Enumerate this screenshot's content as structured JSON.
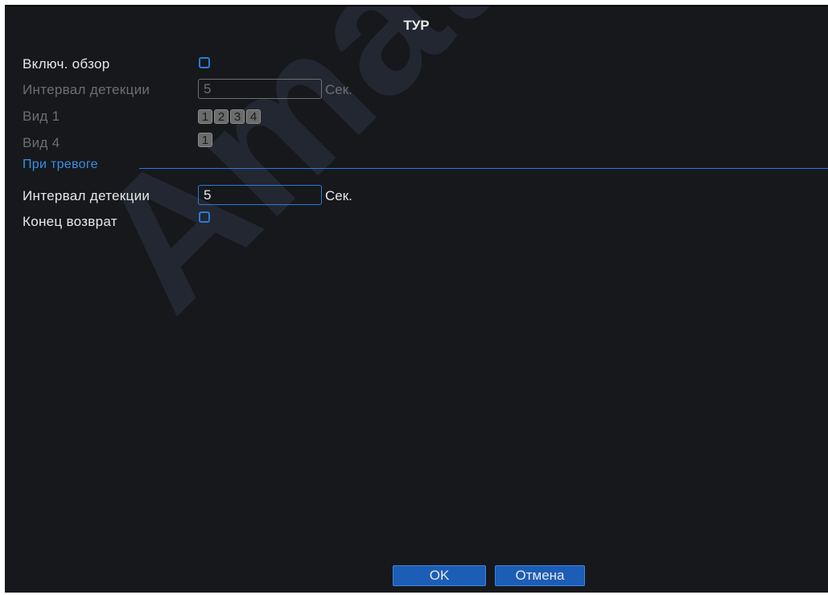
{
  "window": {
    "title": "ТУР"
  },
  "tour": {
    "enable_label": "Включ. обзор",
    "interval_label": "Интервал детекции",
    "interval_value": "5",
    "interval_unit": "Сек.",
    "view1_label": "Вид 1",
    "view1_channels": [
      "1",
      "2",
      "3",
      "4"
    ],
    "view4_label": "Вид 4",
    "view4_channels": [
      "1"
    ]
  },
  "alarm": {
    "section_label": "При тревоге",
    "interval_label": "Интервал детекции",
    "interval_value": "5",
    "interval_unit": "Сек.",
    "return_label": "Конец возврат"
  },
  "watermark": "Amatek",
  "buttons": {
    "ok": "OK",
    "cancel": "Отмена"
  },
  "colors": {
    "accent": "#2d79d9",
    "background": "#16181c",
    "button": "#1c5db5"
  }
}
